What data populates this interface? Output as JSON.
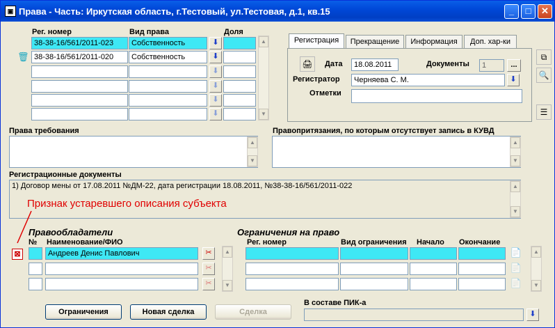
{
  "window": {
    "title": "Права - Часть: Иркутская область, г.Тестовый, ул.Тестовая, д.1, кв.15",
    "app_icon": "app-icon"
  },
  "rights_table": {
    "headers": [
      "Рег. номер",
      "Вид права",
      "Доля"
    ],
    "rows": [
      {
        "reg": "38-38-16/561/2011-023",
        "kind": "Собственность",
        "share": ""
      },
      {
        "reg": "38-38-16/561/2011-020",
        "kind": "Собственность",
        "share": ""
      },
      {
        "reg": "",
        "kind": "",
        "share": ""
      },
      {
        "reg": "",
        "kind": "",
        "share": ""
      },
      {
        "reg": "",
        "kind": "",
        "share": ""
      },
      {
        "reg": "",
        "kind": "",
        "share": ""
      }
    ]
  },
  "tabs": [
    "Регистрация",
    "Прекращение",
    "Информация",
    "Доп. хар-ки"
  ],
  "registration": {
    "date_label": "Дата",
    "date_value": "18.08.2011",
    "documents_label": "Документы",
    "documents_value": "1",
    "ellipsis": "...",
    "registrar_label": "Регистратор",
    "registrar_value": "Черняева С. М.",
    "notes_label": "Отметки",
    "notes_value": ""
  },
  "claims": {
    "label": "Права требования",
    "value": ""
  },
  "pretensions": {
    "label": "Правопритязания, по которым отсутствует запись в КУВД",
    "value": ""
  },
  "reg_documents": {
    "label": "Регистрационные документы",
    "value": "1) Договор мены от 17.08.2011 №ДМ-22, дата регистрации 18.08.2011, №38-38-16/561/2011-022"
  },
  "annotation": "Признак устаревшего описания субъекта",
  "holders": {
    "title": "Правообладатели",
    "col_num": "№",
    "col_name": "Наименование/ФИО",
    "rows": [
      {
        "num": "",
        "name": "Андреев Денис Павлович"
      },
      {
        "num": "",
        "name": ""
      },
      {
        "num": "",
        "name": ""
      }
    ]
  },
  "restrictions": {
    "title": "Ограничения на право",
    "headers": [
      "Рег. номер",
      "Вид ограничения",
      "Начало",
      "Окончание"
    ]
  },
  "buttons": {
    "restrictions": "Ограничения",
    "new_deal": "Новая сделка",
    "deal": "Сделка"
  },
  "pik": {
    "label": "В составе ПИК-а",
    "value": ""
  },
  "colors": {
    "accent_cyan": "#3ee8f5",
    "title_blue": "#0048d8",
    "annotation_red": "#e00000"
  }
}
